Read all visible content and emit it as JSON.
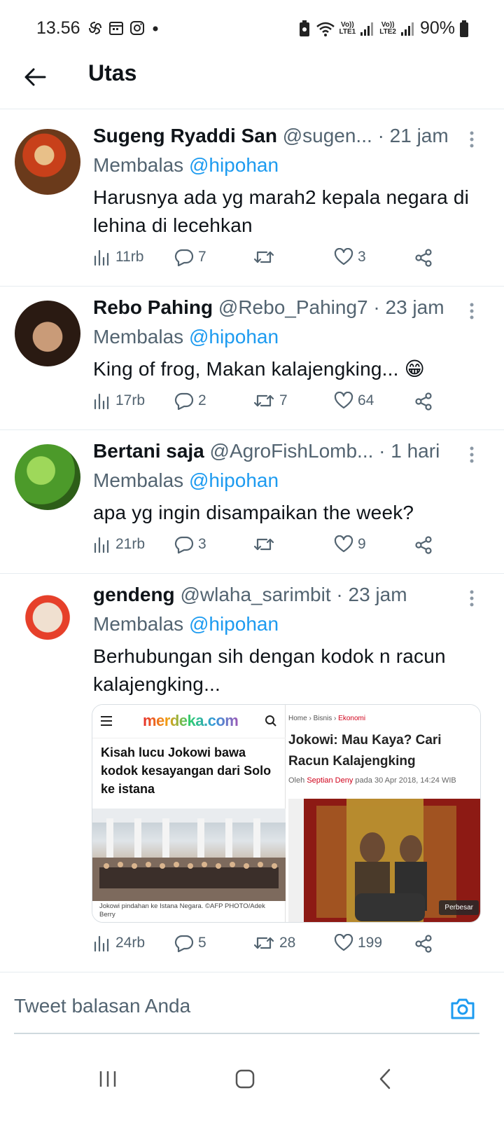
{
  "status_bar": {
    "time": "13.56",
    "network1": "LTE1",
    "network2": "LTE2",
    "volte": "Vo))",
    "battery": "90%"
  },
  "header": {
    "title": "Utas"
  },
  "tweets": [
    {
      "name": "Sugeng Ryaddi San",
      "handle": "@sugen...",
      "time": "· 21 jam",
      "reply_prefix": "Membalas",
      "reply_to": "@hipohan",
      "text": "Harusnya ada yg marah2 kepala negara di lehina di lecehkan",
      "views": "11rb",
      "replies": "7",
      "retweets": "",
      "likes": "3"
    },
    {
      "name": "Rebo Pahing",
      "handle": "@Rebo_Pahing7",
      "time": "· 23 jam",
      "reply_prefix": "Membalas",
      "reply_to": "@hipohan",
      "text": "King of frog, Makan kalajengking... 😁",
      "views": "17rb",
      "replies": "2",
      "retweets": "7",
      "likes": "64"
    },
    {
      "name": "Bertani saja",
      "handle": "@AgroFishLomb...",
      "time": "· 1 hari",
      "reply_prefix": "Membalas",
      "reply_to": "@hipohan",
      "text": "apa yg ingin disampaikan the week?",
      "views": "21rb",
      "replies": "3",
      "retweets": "",
      "likes": "9"
    },
    {
      "name": "gendeng",
      "handle": "@wlaha_sarimbit",
      "time": "· 23 jam",
      "reply_prefix": "Membalas",
      "reply_to": "@hipohan",
      "text": "Berhubungan sih dengan kodok n racun kalajengking...",
      "views": "24rb",
      "replies": "5",
      "retweets": "28",
      "likes": "199",
      "media": {
        "left": {
          "logo": "merdeka.com",
          "headline": "Kisah lucu Jokowi bawa kodok kesayangan dari Solo ke istana",
          "caption": "Jokowi pindahan ke Istana Negara. ©AFP PHOTO/Adek Berry"
        },
        "right": {
          "crumb1": "Home",
          "crumb2": "Bisnis",
          "crumb3": "Ekonomi",
          "headline": "Jokowi: Mau Kaya? Cari Racun Kalajengking",
          "author_prefix": "Oleh",
          "author": "Septian Deny",
          "date": "pada 30 Apr 2018, 14:24 WIB",
          "enlarge": "Perbesar"
        }
      }
    }
  ],
  "reply_box": {
    "placeholder": "Tweet balasan Anda"
  },
  "colors": {
    "accent": "#1d9bf0",
    "text": "#0f1419",
    "muted": "#536471",
    "divider": "#e6ecf0"
  }
}
